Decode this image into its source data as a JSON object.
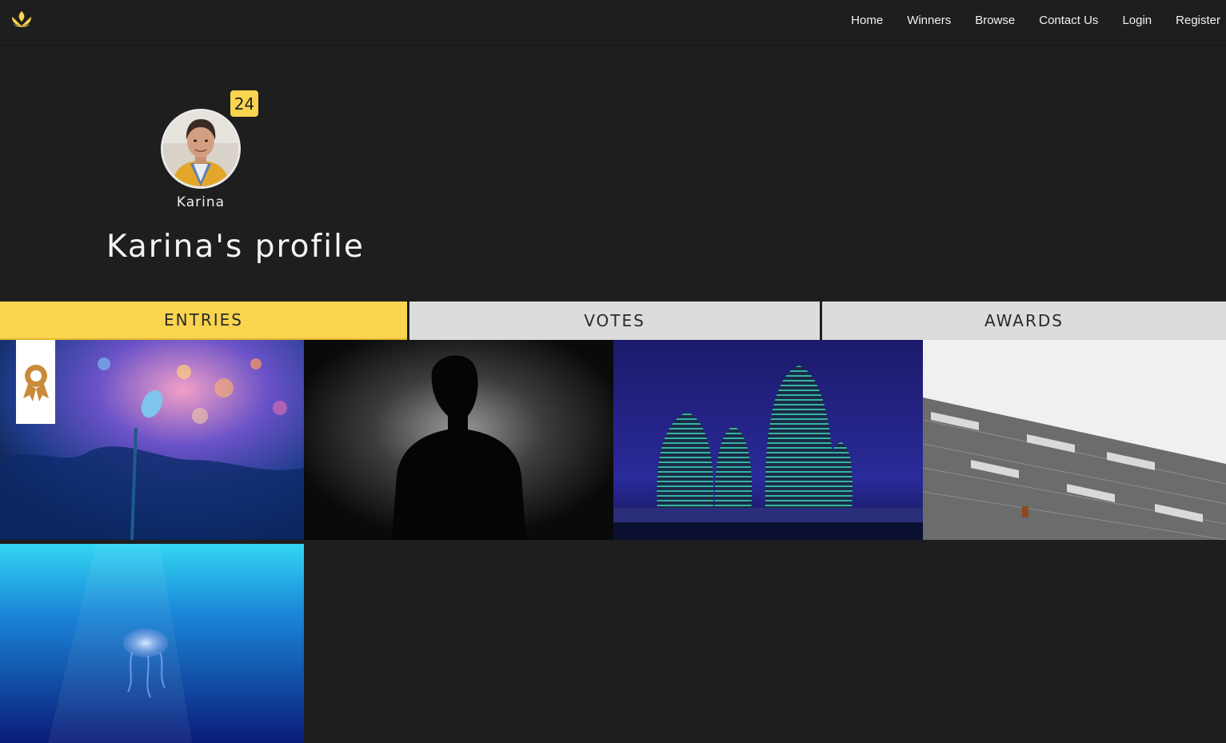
{
  "nav": {
    "logo_icon": "lotus-logo-icon",
    "items": [
      "Home",
      "Winners",
      "Browse",
      "Contact Us",
      "Login",
      "Register"
    ]
  },
  "profile": {
    "entry_count": "24",
    "username": "Karina",
    "title": "Karina's profile"
  },
  "tabs": [
    "ENTRIES",
    "VOTES",
    "AWARDS"
  ],
  "active_tab": "ENTRIES",
  "entries": [
    {
      "subject": "microphone",
      "award_icon": "award-ribbon-icon"
    },
    {
      "subject": "silhouette"
    },
    {
      "subject": "night-towers"
    },
    {
      "subject": "building-facade"
    },
    {
      "subject": "jellyfish"
    }
  ],
  "colors": {
    "accent": "#f9d44f",
    "background": "#1e1e1e",
    "tab_inactive": "#dcdcdc",
    "award": "#c98a3a"
  }
}
